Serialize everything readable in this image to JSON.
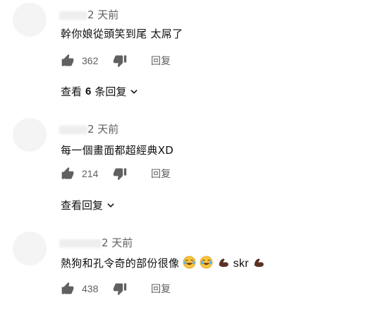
{
  "comments": [
    {
      "time": "2 天前",
      "text": "幹你娘從頭笑到尾 太屌了",
      "likes": "362",
      "reply_label": "回复",
      "view_replies": {
        "prefix": "查看",
        "count": "6",
        "suffix": "条回复"
      }
    },
    {
      "time": "2 天前",
      "text": "每一個畫面都超經典XD",
      "likes": "214",
      "reply_label": "回复",
      "view_replies": {
        "prefix": "查看回复",
        "count": "",
        "suffix": ""
      }
    },
    {
      "time": "2 天前",
      "text_main": "熱狗和孔令奇的部份很像",
      "text_skr": "skr",
      "likes": "438",
      "reply_label": "回复"
    }
  ],
  "icons": {
    "like": "thumb-up-icon",
    "dislike": "thumb-down-icon",
    "expand": "chevron-down-icon",
    "emoji_laugh": "face-with-tears-of-joy-emoji",
    "emoji_flex": "flexed-biceps-emoji"
  },
  "colors": {
    "text": "#0f0f0f",
    "secondary": "#606060",
    "icon": "#606060"
  }
}
